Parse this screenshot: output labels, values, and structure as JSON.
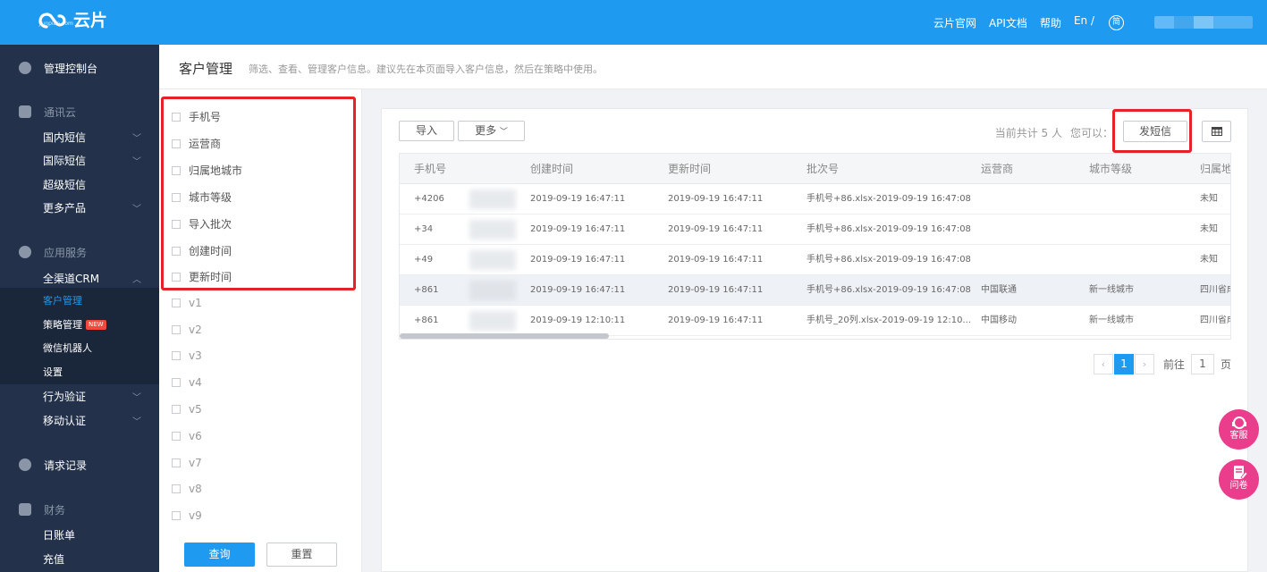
{
  "topbar": {
    "logo_text": "云片",
    "logo_sub": "yunpian.com",
    "nav": [
      "云片官网",
      "API文档",
      "帮助"
    ],
    "lang_en": "En /",
    "lang_cn": "简"
  },
  "sidebar": {
    "dashboard": "管理控制台",
    "group1_title": "通讯云",
    "group1_items": [
      "国内短信",
      "国际短信",
      "超级短信",
      "更多产品"
    ],
    "group2_title": "应用服务",
    "crm": "全渠道CRM",
    "crm_items": [
      "客户管理",
      "策略管理",
      "微信机器人",
      "设置"
    ],
    "new_badge": "NEW",
    "group2_items": [
      "行为验证",
      "移动认证"
    ],
    "requests": "请求记录",
    "finance_title": "财务",
    "finance_items": [
      "日账单",
      "充值"
    ]
  },
  "header": {
    "title": "客户管理",
    "desc": "筛选、查看、管理客户信息。建议先在本页面导入客户信息，然后在策略中使用。"
  },
  "filter": {
    "fields": [
      "手机号",
      "运营商",
      "归属地城市",
      "城市等级",
      "导入批次",
      "创建时间",
      "更新时间",
      "v1",
      "v2",
      "v3",
      "v4",
      "v5",
      "v6",
      "v7",
      "v8",
      "v9"
    ],
    "query_label": "查询",
    "reset_label": "重置"
  },
  "toolbar": {
    "import_label": "导入",
    "more_label": "更多",
    "summary": "当前共计 5 人",
    "you_can": "您可以：",
    "send_sms_label": "发短信"
  },
  "table": {
    "columns": [
      "手机号",
      "创建时间",
      "更新时间",
      "批次号",
      "运营商",
      "城市等级",
      "归属地"
    ],
    "rows": [
      [
        "+4206",
        "2019-09-19 16:47:11",
        "2019-09-19 16:47:11",
        "手机号+86.xlsx-2019-09-19 16:47:08",
        "",
        "",
        "未知"
      ],
      [
        "+34",
        "2019-09-19 16:47:11",
        "2019-09-19 16:47:11",
        "手机号+86.xlsx-2019-09-19 16:47:08",
        "",
        "",
        "未知"
      ],
      [
        "+49",
        "2019-09-19 16:47:11",
        "2019-09-19 16:47:11",
        "手机号+86.xlsx-2019-09-19 16:47:08",
        "",
        "",
        "未知"
      ],
      [
        "+861",
        "2019-09-19 16:47:11",
        "2019-09-19 16:47:11",
        "手机号+86.xlsx-2019-09-19 16:47:08",
        "中国联通",
        "新一线城市",
        "四川省成"
      ],
      [
        "+861",
        "2019-09-19 12:10:11",
        "2019-09-19 16:47:11",
        "手机号_20列.xlsx-2019-09-19 12:10...",
        "中国移动",
        "新一线城市",
        "四川省成"
      ]
    ],
    "highlight_row": 3
  },
  "pagination": {
    "current": "1",
    "goto_label": "前往",
    "goto_value": "1",
    "page_label": "页"
  },
  "floating": {
    "service_label": "客服",
    "survey_label": "问卷"
  },
  "colors": {
    "brand": "#1e9af0",
    "sidebar_bg": "#23324a",
    "annotation_red": "#e5222a",
    "floating_pink": "#ea3d8c"
  }
}
